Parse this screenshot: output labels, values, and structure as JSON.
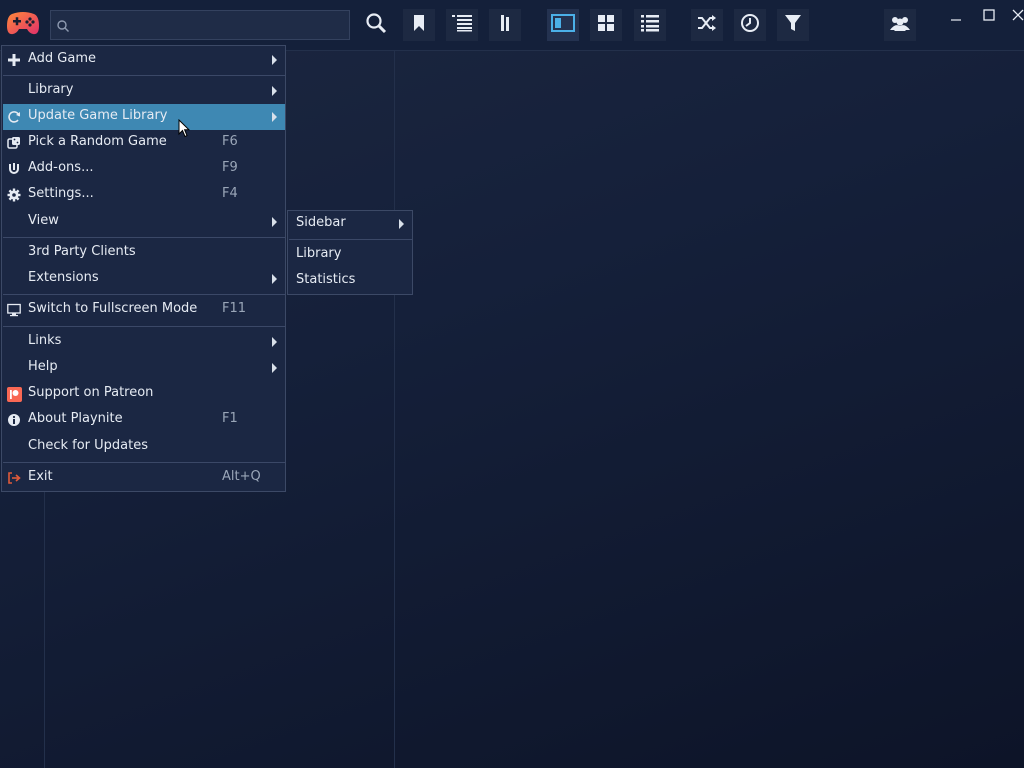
{
  "search": {
    "value": "",
    "placeholder": ""
  },
  "toolbar": {
    "icons": [
      "search-icon",
      "bookmark-icon",
      "list-view-icon",
      "grouping-icon",
      "sidebar-view-icon",
      "grid-view-icon",
      "details-view-icon",
      "shuffle-icon",
      "clock-icon",
      "filter-icon",
      "users-icon"
    ]
  },
  "colors": {
    "accent": "#3e88b3",
    "background": "#15203a",
    "menu": "#1b2743",
    "exit": "#e05a3a",
    "patreon": "#f96854"
  },
  "menu": {
    "items": [
      {
        "label": "Add Game",
        "shortcut": "",
        "icon": "plus-icon",
        "submenu": true
      },
      {
        "label": "Library",
        "shortcut": "",
        "icon": "",
        "submenu": true
      },
      {
        "label": "Update Game Library",
        "shortcut": "",
        "icon": "refresh-icon",
        "submenu": true,
        "highlighted": true
      },
      {
        "label": "Pick a Random Game",
        "shortcut": "F6",
        "icon": "dice-icon",
        "submenu": false
      },
      {
        "label": "Add-ons...",
        "shortcut": "F9",
        "icon": "plug-icon",
        "submenu": false
      },
      {
        "label": "Settings...",
        "shortcut": "F4",
        "icon": "gear-icon",
        "submenu": false
      },
      {
        "label": "View",
        "shortcut": "",
        "icon": "",
        "submenu": true
      },
      {
        "label": "3rd Party Clients",
        "shortcut": "",
        "icon": "",
        "submenu": false
      },
      {
        "label": "Extensions",
        "shortcut": "",
        "icon": "",
        "submenu": true
      },
      {
        "label": "Switch to Fullscreen Mode",
        "shortcut": "F11",
        "icon": "monitor-icon",
        "submenu": false
      },
      {
        "label": "Links",
        "shortcut": "",
        "icon": "",
        "submenu": true
      },
      {
        "label": "Help",
        "shortcut": "",
        "icon": "",
        "submenu": true
      },
      {
        "label": "Support on Patreon",
        "shortcut": "",
        "icon": "patreon-icon",
        "submenu": false
      },
      {
        "label": "About Playnite",
        "shortcut": "F1",
        "icon": "info-icon",
        "submenu": false
      },
      {
        "label": "Check for Updates",
        "shortcut": "",
        "icon": "",
        "submenu": false
      },
      {
        "label": "Exit",
        "shortcut": "Alt+Q",
        "icon": "exit-icon",
        "submenu": false
      }
    ]
  },
  "view_submenu": {
    "items": [
      {
        "label": "Sidebar",
        "submenu": true
      },
      {
        "label": "Library",
        "submenu": false
      },
      {
        "label": "Statistics",
        "submenu": false
      }
    ]
  }
}
